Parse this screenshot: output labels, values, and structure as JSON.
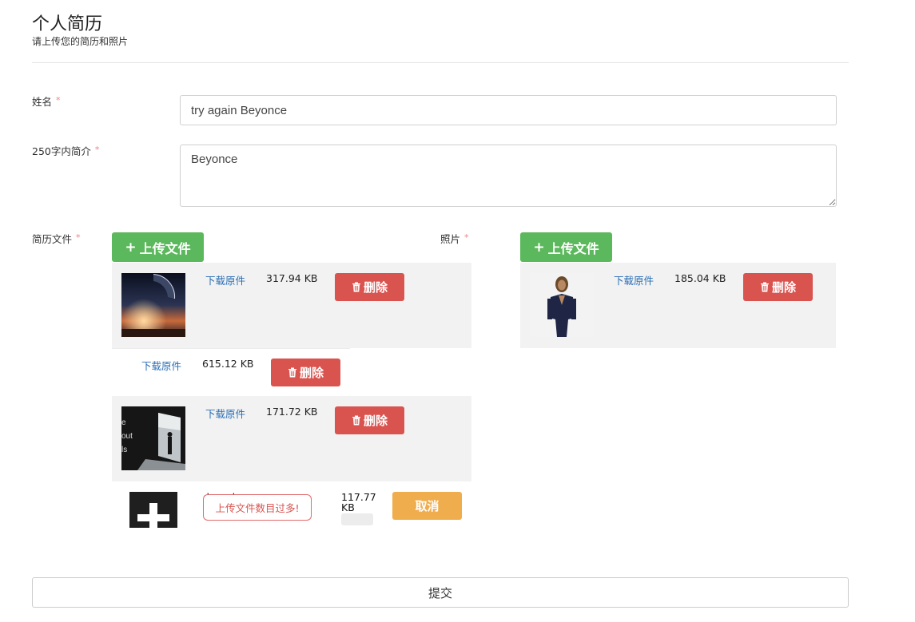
{
  "header": {
    "title": "个人简历",
    "subtitle": "请上传您的简历和照片"
  },
  "form": {
    "name": {
      "label": "姓名",
      "required_mark": "*",
      "value": "try again Beyonce"
    },
    "bio": {
      "label": "250字内简介",
      "required_mark": "*",
      "value": "Beyonce"
    },
    "resume": {
      "label": "简历文件",
      "required_mark": "*",
      "upload_label": "上传文件",
      "files": [
        {
          "link": "下载原件",
          "size": "317.94 KB",
          "delete_label": "删除"
        },
        {
          "link": "下载原件",
          "size": "615.12 KB",
          "delete_label": "删除"
        },
        {
          "link": "下载原件",
          "size": "171.72 KB",
          "delete_label": "删除"
        }
      ],
      "pending": {
        "name": "doc_plus.png",
        "error": "上传文件数目过多!",
        "size_line1": "117.77",
        "size_line2": "KB",
        "cancel_label": "取消"
      }
    },
    "photo": {
      "label": "照片",
      "required_mark": "*",
      "upload_label": "上传文件",
      "files": [
        {
          "link": "下载原件",
          "size": "185.04 KB",
          "delete_label": "删除"
        }
      ]
    },
    "submit_label": "提交"
  },
  "thumb_text": {
    "line1": "e",
    "line2": "out",
    "line3": "ls"
  },
  "colors": {
    "success": "#5cb85c",
    "danger": "#d9534f",
    "warning": "#f0ad4e",
    "link": "#2a6fb5"
  },
  "icons": {
    "upload": "plus-icon",
    "delete": "trash-icon"
  }
}
